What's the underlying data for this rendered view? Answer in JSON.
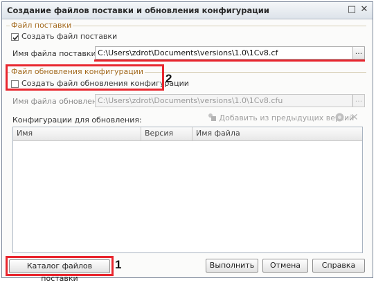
{
  "window": {
    "title": "Создание файлов поставки и обновления конфигурации",
    "restore_glyph": "□",
    "close_glyph": "✕"
  },
  "supply_group": {
    "label": "Файл поставки",
    "create_checkbox_label": "Создать файл поставки",
    "create_checked": true,
    "file_label": "Имя файла поставки:",
    "file_value": "C:\\Users\\zdrot\\Documents\\versions\\1.0\\1Cv8.cf",
    "browse_glyph": "..."
  },
  "update_group": {
    "label": "Файл обновления конфигурации",
    "create_checkbox_label": "Создать файл обновления конфигурации",
    "create_checked": false,
    "file_label": "Имя файла обновления:",
    "file_value": "C:\\Users\\zdrot\\Documents\\versions\\1.0\\1Cv8.cfu",
    "browse_glyph": "..."
  },
  "configs": {
    "label": "Конфигурации для обновления:",
    "add_prev_label": "Добавить из предыдущих версий",
    "columns": [
      "Имя",
      "Версия",
      "Имя файла"
    ],
    "rows": []
  },
  "buttons": {
    "catalog": "Каталог файлов поставки",
    "run": "Выполнить",
    "cancel": "Отмена",
    "help": "Справка"
  },
  "annotations": {
    "marker_1": "1",
    "marker_2": "2"
  },
  "colors": {
    "highlight": "#e8262e",
    "group_label": "#a36a1e",
    "accent_title_bar": "#dde3ea"
  }
}
